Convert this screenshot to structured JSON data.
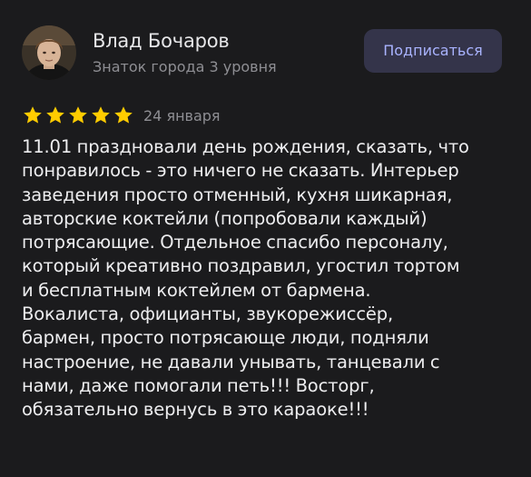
{
  "author": {
    "name": "Влад Бочаров",
    "level": "Знаток города 3 уровня"
  },
  "subscribe_label": "Подписаться",
  "rating": {
    "stars": 5,
    "max": 5,
    "star_color": "#ffcc00"
  },
  "date": "24 января",
  "review_lines": [
    "11.01 праздновали день рождения, сказать, что",
    "понравилось - это ничего не сказать. Интерьер",
    "заведения просто отменный, кухня шикарная,",
    "авторские коктейли (попробовали каждый)",
    "потрясающие. Отдельное спасибо персоналу,",
    "который креативно поздравил, угостил тортом",
    "и бесплатным коктейлем от бармена.",
    "Вокалиста, официанты, звукорежиссёр,",
    "бармен, просто потрясающе люди, подняли",
    "настроение, не давали унывать, танцевали с",
    "нами, даже помогали петь!!! Восторг,",
    "обязательно вернусь в это караоке!!!"
  ],
  "colors": {
    "background": "#1b1b1d",
    "button_bg": "#34344a",
    "button_text": "#a9b3ff",
    "primary_text": "#ededef",
    "secondary_text": "#8e8e93"
  }
}
